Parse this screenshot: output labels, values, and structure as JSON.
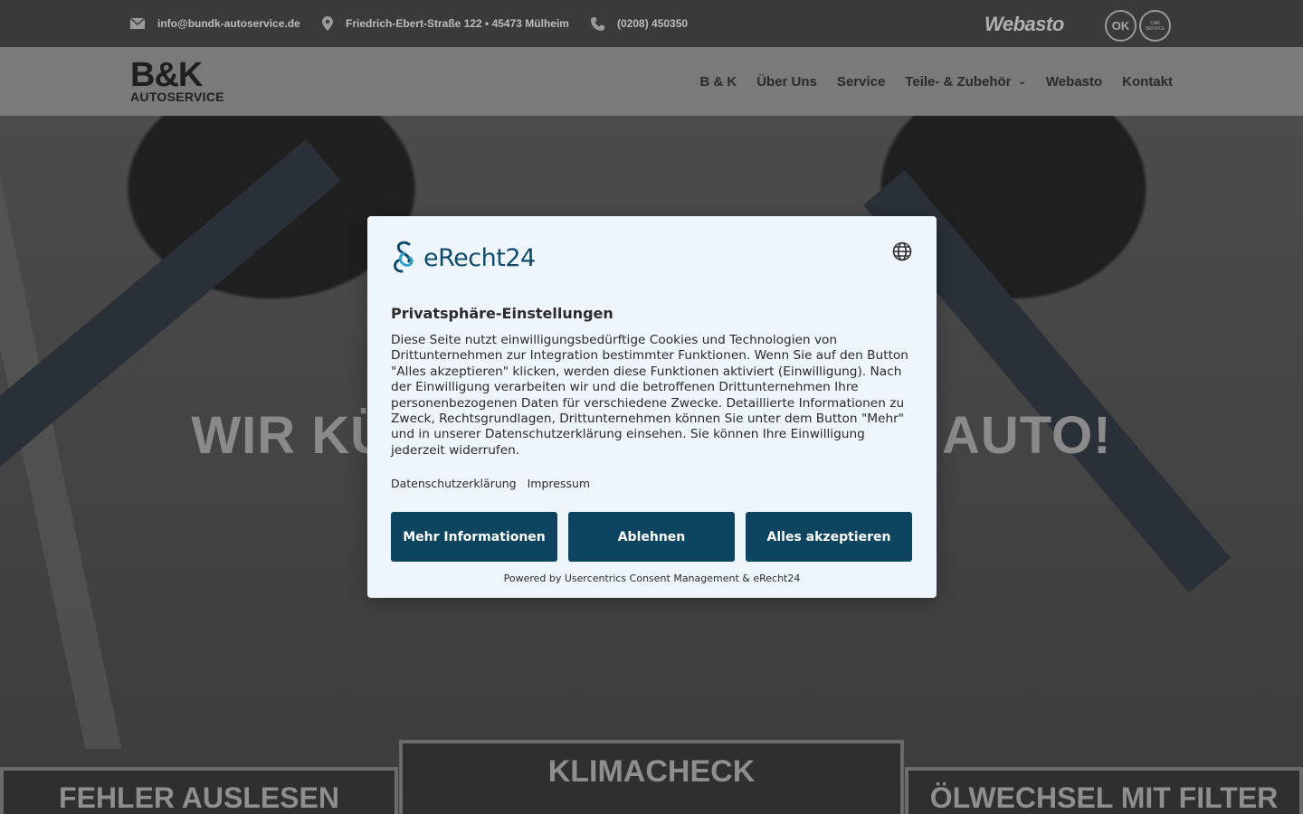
{
  "topbar": {
    "email": "info@bundk-autoservice.de",
    "address": "Friedrich-Ebert-Straße 122 • 45473 Mülheim",
    "phone": "(0208) 450350",
    "partner_logo": "Webasto",
    "badge_ok": "OK",
    "badge_car": "CAR SERVICE",
    "icons": [
      "mail-icon",
      "location-pin-icon",
      "phone-icon"
    ]
  },
  "header": {
    "logo_main": "B&K",
    "logo_sub": "AUTOSERVICE",
    "nav": [
      {
        "label": "B & K"
      },
      {
        "label": "Über Uns"
      },
      {
        "label": "Service"
      },
      {
        "label": "Teile- & Zubehör"
      },
      {
        "label": "Webasto"
      },
      {
        "label": "Kontakt"
      }
    ]
  },
  "hero": {
    "title": "WIR KÜMMERN UNS UM IHR AUTO!",
    "tiles": [
      {
        "label": "FEHLER AUSLESEN"
      },
      {
        "label": "KLIMACHECK"
      },
      {
        "label": "ÖLWECHSEL MIT FILTER"
      }
    ]
  },
  "consent": {
    "brand": "eRecht24",
    "title": "Privatsphäre-Einstellungen",
    "body": "Diese Seite nutzt einwilligungsbedürftige Cookies und Technologien von Drittunternehmen zur Integration bestimmter Funktionen. Wenn Sie auf den Button \"Alles akzeptieren\" klicken, werden diese Funktionen aktiviert (Einwilligung). Nach der Einwilligung verarbeiten wir und die betroffenen Drittunternehmen Ihre personenbezogenen Daten für verschiedene Zwecke. Detaillierte Informationen zu Zweck, Rechtsgrundlagen, Drittunternehmen können Sie unter dem Button \"Mehr\" und in unserer Datenschutzerklärung einsehen. Sie können Ihre Einwilligung jederzeit widerrufen.",
    "links": [
      "Datenschutzerklärung",
      "Impressum"
    ],
    "buttons": {
      "more": "Mehr Informationen",
      "decline": "Ablehnen",
      "accept": "Alles akzeptieren"
    },
    "powered_by": "Powered by Usercentrics Consent Management & eRecht24"
  },
  "colors": {
    "button_bg": "#0d4560",
    "brand_text": "#0f4c6b",
    "dialog_bg": "#eef5fb"
  }
}
